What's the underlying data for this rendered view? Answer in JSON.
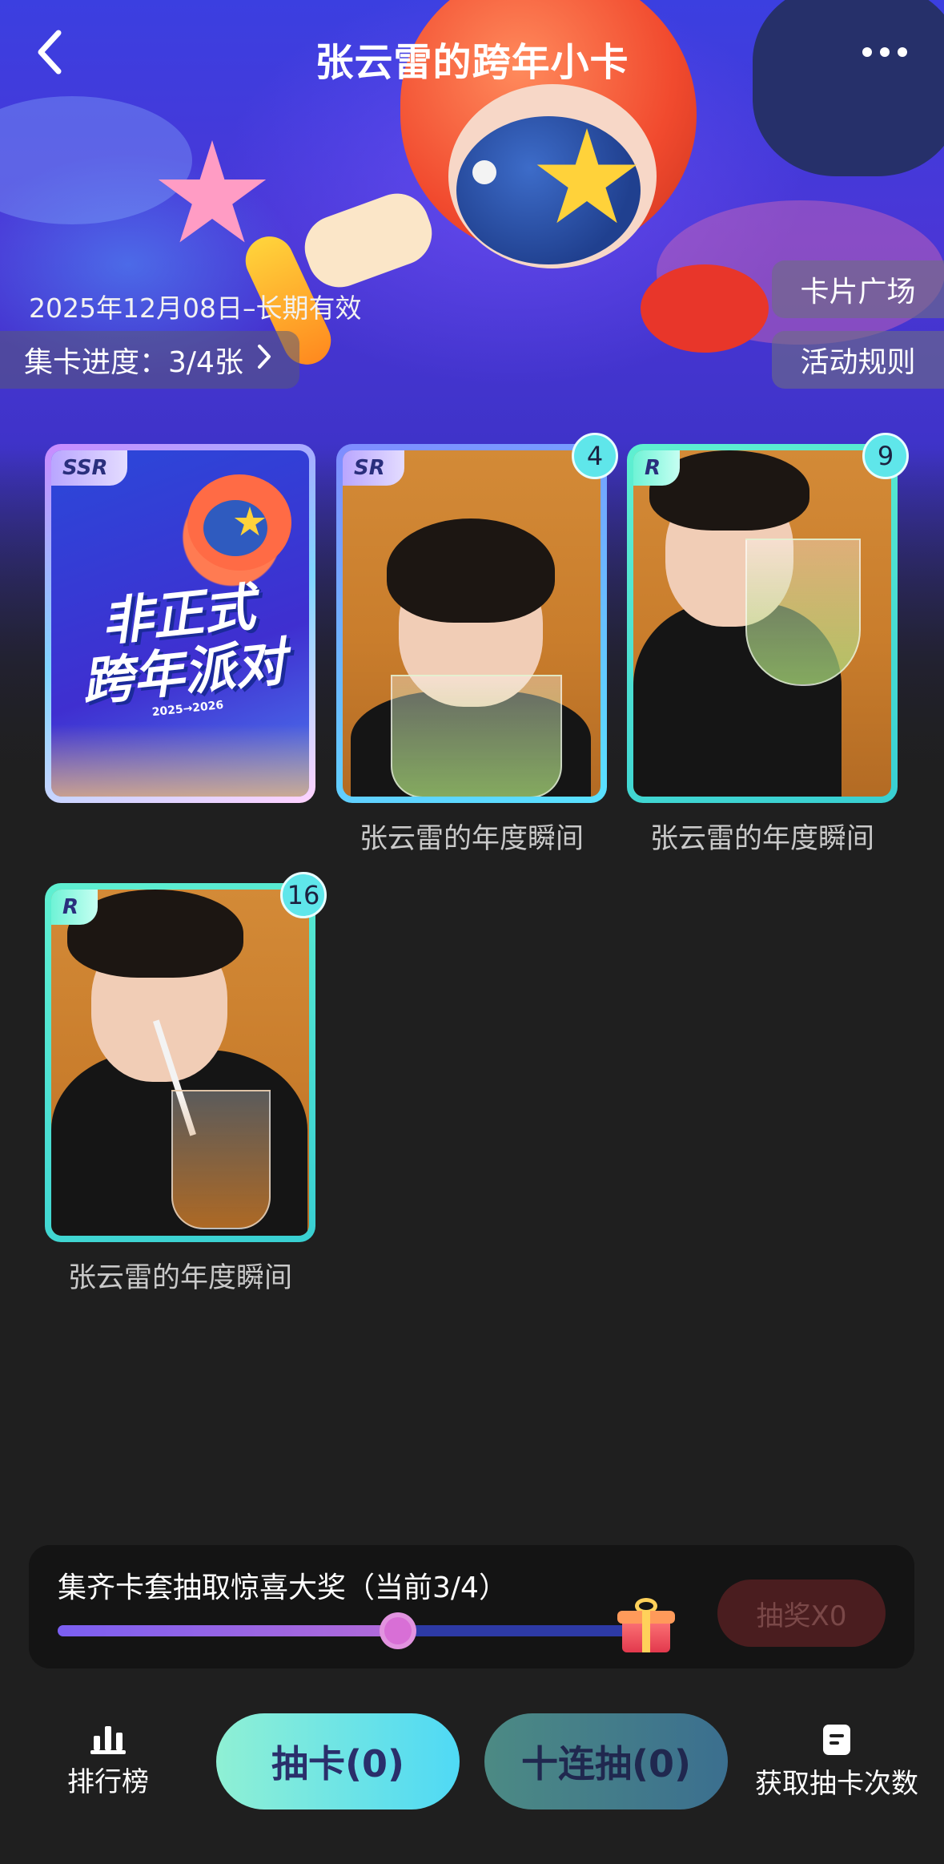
{
  "header": {
    "title": "张云雷的跨年小卡",
    "back_icon": "chevron-left-icon",
    "more_icon": "more-horizontal-icon"
  },
  "banner": {
    "validity": "2025年12月08日–长期有效",
    "progress_label": "集卡进度：3/4张",
    "progress_chevron": "›",
    "card_square_button": "卡片广场",
    "rules_button": "活动规则"
  },
  "cards": [
    {
      "rarity": "SSR",
      "count": "",
      "caption": "",
      "art_text_line1": "非正式",
      "art_text_line2": "跨年派对",
      "art_subtext": "2025→2026"
    },
    {
      "rarity": "SR",
      "count": "4",
      "caption": "张云雷的年度瞬间"
    },
    {
      "rarity": "R",
      "count": "9",
      "caption": "张云雷的年度瞬间"
    },
    {
      "rarity": "R",
      "count": "16",
      "caption": "张云雷的年度瞬间"
    }
  ],
  "reward": {
    "title": "集齐卡套抽取惊喜大奖（当前3/4）",
    "progress_fraction": 0.75,
    "lottery_button": "抽奖X0",
    "gift_icon": "gift-icon"
  },
  "bottom_bar": {
    "leaderboard_label": "排行榜",
    "leaderboard_icon": "bar-chart-icon",
    "draw_one": "抽卡(0)",
    "draw_ten": "十连抽(0)",
    "get_draws_label": "获取抽卡次数",
    "get_draws_icon": "document-icon"
  },
  "colors": {
    "background": "#1f1f1f",
    "accent_cyan": "#4fd9f5",
    "rarity_r": "#5ff0d1",
    "rarity_sr": "#7f8cff",
    "lottery_disabled": "#4a1d1f"
  }
}
